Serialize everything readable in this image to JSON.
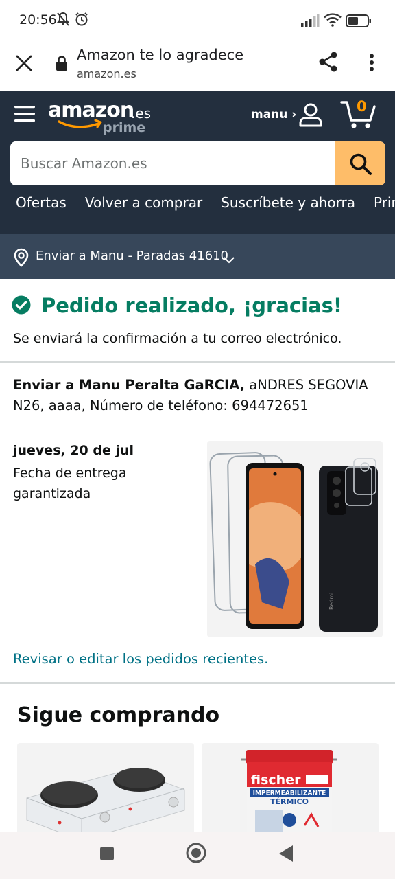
{
  "status_bar": {
    "time": "20:56"
  },
  "browser": {
    "title": "Amazon te lo agradece",
    "url": "amazon.es"
  },
  "header": {
    "logo": {
      "word": "amazon",
      "tld": ".es",
      "tier": "prime"
    },
    "user_label": "manu ›",
    "cart_count": "0",
    "search_placeholder": "Buscar Amazon.es",
    "nav_links": [
      "Ofertas",
      "Volver a comprar",
      "Suscríbete y ahorra",
      "Prime"
    ],
    "location": "Enviar a Manu - Paradas 41610"
  },
  "confirmation": {
    "headline": "Pedido realizado, ¡gracias!",
    "subtext": "Se enviará la confirmación a tu correo electrónico."
  },
  "shipping": {
    "label": "Enviar a Manu Peralta GaRCIA,",
    "address": " aNDRES SEGOVIA N26, aaaa, Número de teléfono: 694472651"
  },
  "delivery": {
    "date": "jueves, 20 de jul",
    "note": "Fecha de entrega garantizada"
  },
  "product": {
    "image_icon": "phone-screen-protector-image",
    "brand_on_phone": "Redmi"
  },
  "review_link": "Revisar o editar los pedidos recientes.",
  "keep_shopping": {
    "title": "Sigue comprando",
    "items": [
      {
        "image_icon": "electric-hotplate-image"
      },
      {
        "image_icon": "fischer-paint-bucket-image",
        "brand": "fischer",
        "label_line1": "IMPERMEABILIZANTE",
        "label_line2": "TÉRMICO"
      }
    ]
  },
  "colors": {
    "header_bg": "#232f3e",
    "location_bg": "#37475a",
    "search_button": "#febd69",
    "success_green": "#067d62",
    "link_teal": "#007185",
    "accent_orange": "#ff9900"
  }
}
